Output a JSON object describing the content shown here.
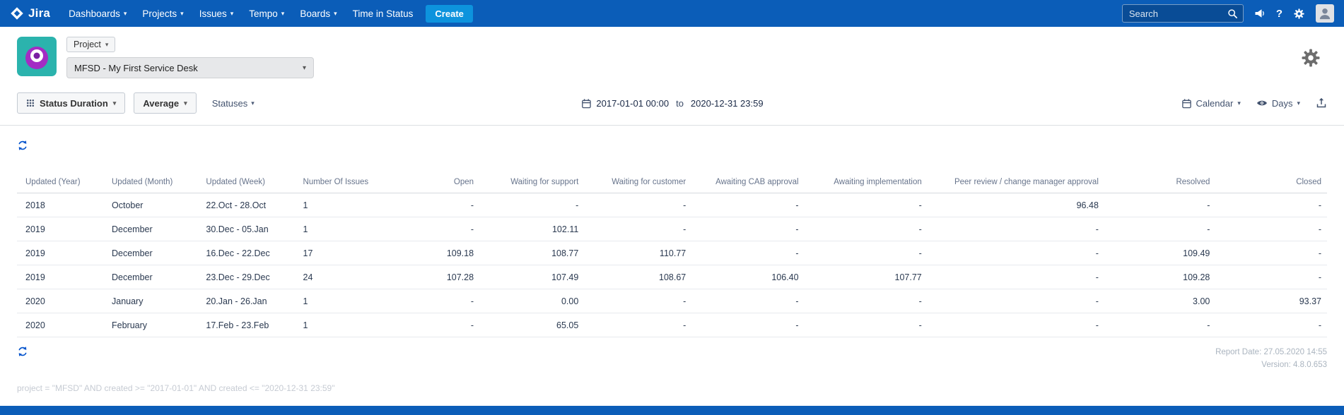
{
  "colors": {
    "nav_bg": "#0b5db8",
    "create_bg": "#0d93dd",
    "accent": "#0052cc",
    "muted": "#aab4bf"
  },
  "nav": {
    "brand": "Jira",
    "items": [
      {
        "label": "Dashboards",
        "dropdown": true
      },
      {
        "label": "Projects",
        "dropdown": true
      },
      {
        "label": "Issues",
        "dropdown": true
      },
      {
        "label": "Tempo",
        "dropdown": true
      },
      {
        "label": "Boards",
        "dropdown": true
      },
      {
        "label": "Time in Status",
        "dropdown": false
      }
    ],
    "create_label": "Create",
    "search_placeholder": "Search",
    "icons": {
      "logo": "jira-diamond",
      "search": "magnifier",
      "announcement": "megaphone",
      "help": "question-mark",
      "settings": "gear",
      "avatar": "person"
    }
  },
  "project_bar": {
    "scope_label": "Project",
    "selected_project": "MFSD - My First Service Desk",
    "icons": {
      "avatar": "teal-creature",
      "settings": "gear"
    }
  },
  "toolbar": {
    "report_type": {
      "label": "Status Duration",
      "icon": "grid-dots"
    },
    "aggregation": {
      "label": "Average"
    },
    "statuses": {
      "label": "Statuses"
    },
    "date_from": "2017-01-01 00:00",
    "date_separator": "to",
    "date_to": "2020-12-31 23:59",
    "calendar": {
      "label": "Calendar",
      "icon": "calendar"
    },
    "units": {
      "label": "Days",
      "icon": "eye"
    },
    "export_icon": "upload-arrow",
    "refresh_icon": "circular-arrows"
  },
  "table": {
    "columns": [
      "Updated (Year)",
      "Updated (Month)",
      "Updated (Week)",
      "Number Of Issues",
      "Open",
      "Waiting for support",
      "Waiting for customer",
      "Awaiting CAB approval",
      "Awaiting implementation",
      "Peer review / change manager approval",
      "Resolved",
      "Closed"
    ],
    "rows": [
      [
        "2018",
        "October",
        "22.Oct - 28.Oct",
        "1",
        "-",
        "-",
        "-",
        "-",
        "-",
        "96.48",
        "-",
        "-"
      ],
      [
        "2019",
        "December",
        "30.Dec - 05.Jan",
        "1",
        "-",
        "102.11",
        "-",
        "-",
        "-",
        "-",
        "-",
        "-"
      ],
      [
        "2019",
        "December",
        "16.Dec - 22.Dec",
        "17",
        "109.18",
        "108.77",
        "110.77",
        "-",
        "-",
        "-",
        "109.49",
        "-"
      ],
      [
        "2019",
        "December",
        "23.Dec - 29.Dec",
        "24",
        "107.28",
        "107.49",
        "108.67",
        "106.40",
        "107.77",
        "-",
        "109.28",
        "-"
      ],
      [
        "2020",
        "January",
        "20.Jan - 26.Jan",
        "1",
        "-",
        "0.00",
        "-",
        "-",
        "-",
        "-",
        "3.00",
        "93.37"
      ],
      [
        "2020",
        "February",
        "17.Feb - 23.Feb",
        "1",
        "-",
        "65.05",
        "-",
        "-",
        "-",
        "-",
        "-",
        "-"
      ]
    ]
  },
  "footer": {
    "report_date": "Report Date: 27.05.2020 14:55",
    "version": "Version: 4.8.0.653",
    "query": "project = \"MFSD\" AND created >= \"2017-01-01\" AND created <= \"2020-12-31 23:59\""
  }
}
